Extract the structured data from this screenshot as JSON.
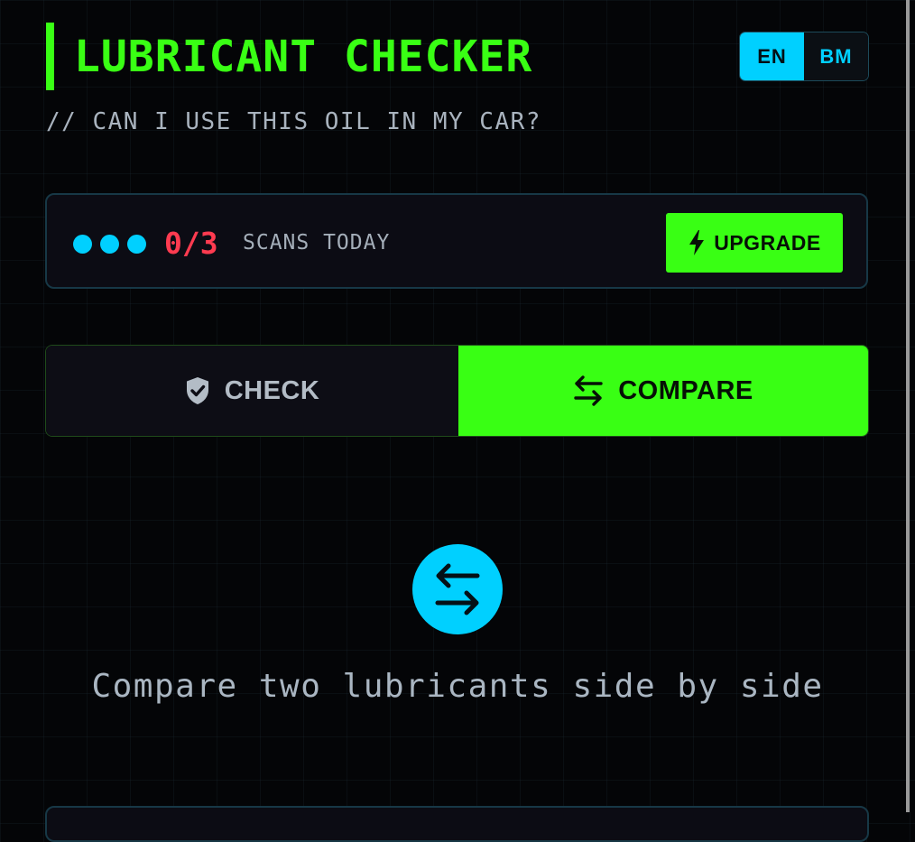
{
  "header": {
    "title": "LUBRICANT CHECKER",
    "subtitle": "// CAN I USE THIS OIL IN MY CAR?"
  },
  "language": {
    "options": [
      {
        "label": "EN",
        "active": true
      },
      {
        "label": "BM",
        "active": false
      }
    ]
  },
  "quota": {
    "count": "0/3",
    "label": "SCANS TODAY",
    "dots": 3,
    "upgrade_label": "UPGRADE",
    "upgrade_icon": "lightning-icon"
  },
  "tabs": [
    {
      "label": "CHECK",
      "icon": "shield-check-icon",
      "active": false
    },
    {
      "label": "COMPARE",
      "icon": "swap-arrows-icon",
      "active": true
    }
  ],
  "compare_panel": {
    "icon": "swap-arrows-icon",
    "description": "Compare two lubricants side by side"
  },
  "colors": {
    "accent_green": "#39ff14",
    "accent_cyan": "#00d0ff",
    "alert_red": "#ff3b50",
    "background": "#040507"
  }
}
